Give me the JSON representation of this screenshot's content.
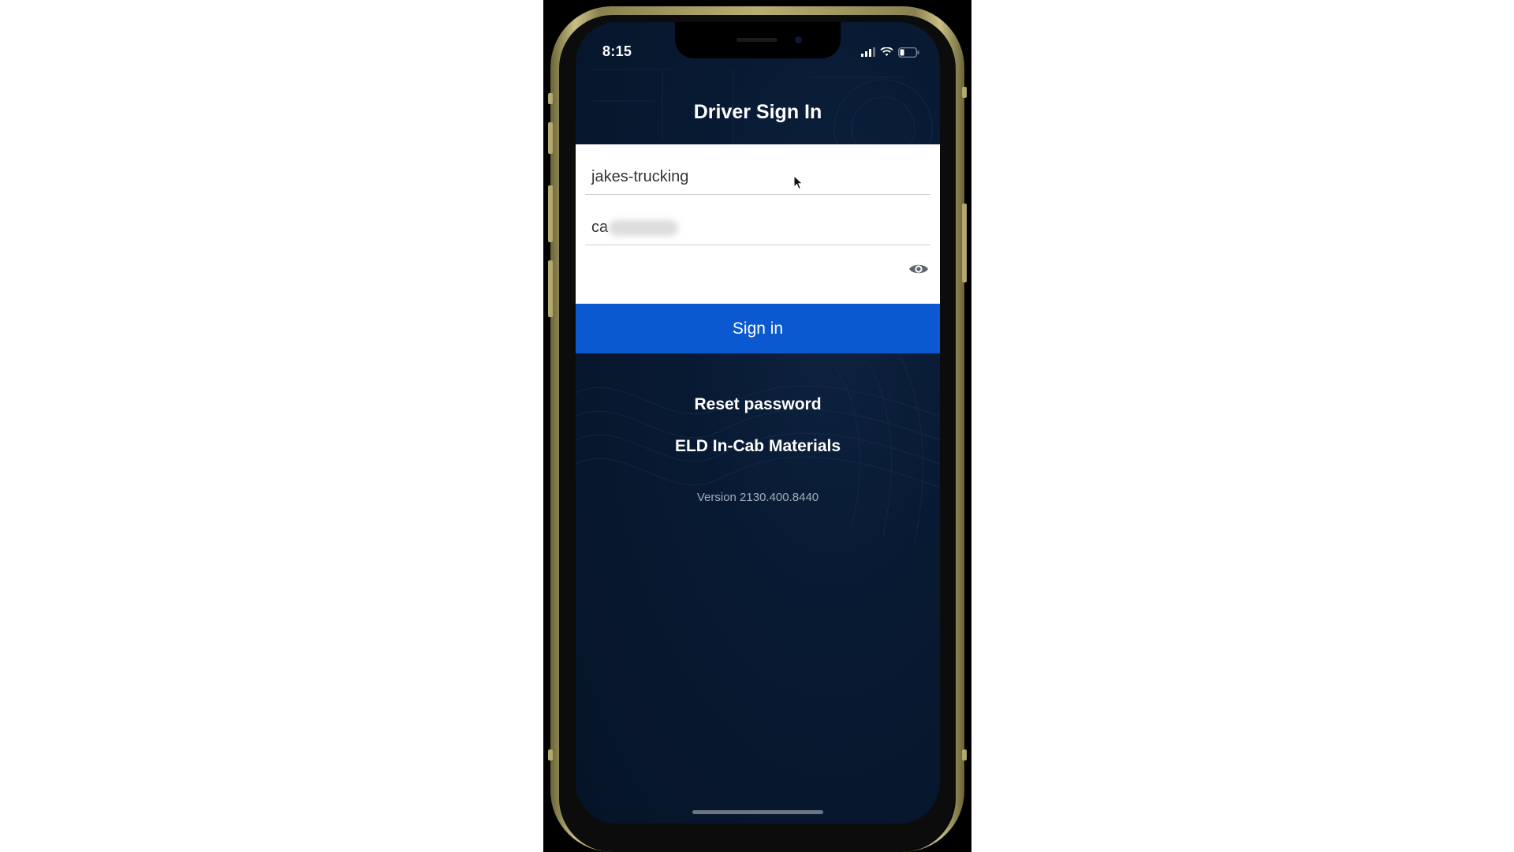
{
  "status_bar": {
    "time": "8:15"
  },
  "screen": {
    "title": "Driver Sign In"
  },
  "form": {
    "company_value": "jakes-trucking",
    "username_visible": "ca",
    "password_value": ""
  },
  "actions": {
    "signin_label": "Sign in",
    "reset_password_label": "Reset password",
    "eld_materials_label": "ELD In-Cab Materials"
  },
  "footer": {
    "version": "Version 2130.400.8440"
  },
  "colors": {
    "background": "#081a33",
    "primary_button": "#0a59d1",
    "card": "#ffffff",
    "frame": "#b9ae72"
  },
  "icons": {
    "password_toggle": "eye-icon",
    "signal": "cellular-signal-icon",
    "wifi": "wifi-icon",
    "battery": "battery-icon"
  }
}
